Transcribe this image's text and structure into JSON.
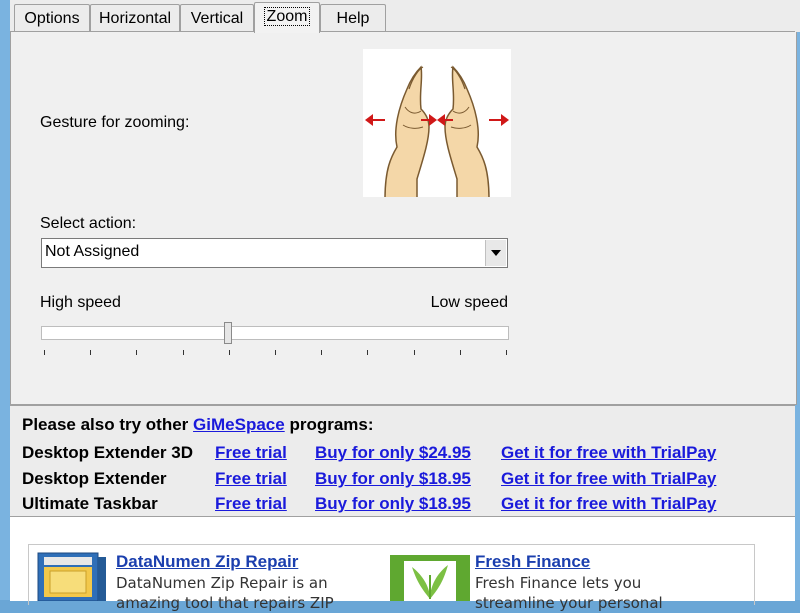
{
  "tabs": [
    {
      "label": "Options",
      "active": false
    },
    {
      "label": "Horizontal",
      "active": false
    },
    {
      "label": "Vertical",
      "active": false
    },
    {
      "label": "Zoom",
      "active": true
    },
    {
      "label": "Help",
      "active": false
    }
  ],
  "zoom": {
    "gesture_label": "Gesture for zooming:",
    "gesture_icon": "two-hands-pinch-zoom-icon",
    "select_label": "Select action:",
    "select_value": "Not Assigned",
    "speed_high_label": "High speed",
    "speed_low_label": "Low speed",
    "speed_value_fraction": 0.4
  },
  "promo": {
    "intro_prefix": "Please also try other",
    "brand_link": "GiMeSpace",
    "intro_suffix": "programs:",
    "products": [
      {
        "name": "Desktop Extender 3D",
        "trial": "Free trial",
        "buy": "Buy for only $24.95",
        "free": "Get it for free with TrialPay"
      },
      {
        "name": "Desktop Extender",
        "trial": "Free trial",
        "buy": "Buy for only $18.95",
        "free": "Get it for free with TrialPay"
      },
      {
        "name": "Ultimate Taskbar",
        "trial": "Free trial",
        "buy": "Buy for only $18.95",
        "free": "Get it for free with TrialPay"
      }
    ]
  },
  "ads": [
    {
      "title": "DataNumen Zip Repair",
      "desc_line1": "DataNumen Zip Repair is an",
      "desc_line2": "amazing tool that repairs ZIP"
    },
    {
      "title": "Fresh Finance",
      "desc_line1": "Fresh Finance lets you",
      "desc_line2": "streamline your personal"
    }
  ],
  "colors": {
    "link": "#1a1adb",
    "ad_title": "#1b3fae",
    "window_frame": "#6aa6d6"
  }
}
